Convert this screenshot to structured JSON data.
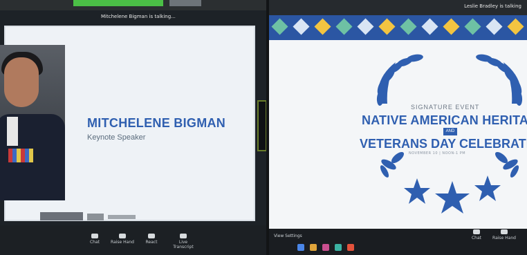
{
  "left_screen": {
    "meeting_label": "Mitchelene Bigman is talking...",
    "speaker_name": "MITCHELENE BIGMAN",
    "speaker_role": "Keynote Speaker",
    "toolbar_labels": [
      "Chat",
      "Raise Hand",
      "React",
      "Live Transcript"
    ]
  },
  "right_screen": {
    "meeting_label": "Leslie Bradley is talking",
    "event_kicker": "SIGNATURE EVENT",
    "title_line1": "NATIVE AMERICAN HERITAGE",
    "and_label": "AND",
    "title_line2": "VETERANS DAY CELEBRATION",
    "date_text": "NOVEMBER 10 | NOON-1 PM",
    "settings_label": "View Settings",
    "toolbar_labels": [
      "Chat",
      "Raise Hand"
    ]
  },
  "colors": {
    "brand_blue": "#2f5fb0",
    "pattern_yellow": "#f3c441",
    "zoom_green": "#4bbf46"
  }
}
